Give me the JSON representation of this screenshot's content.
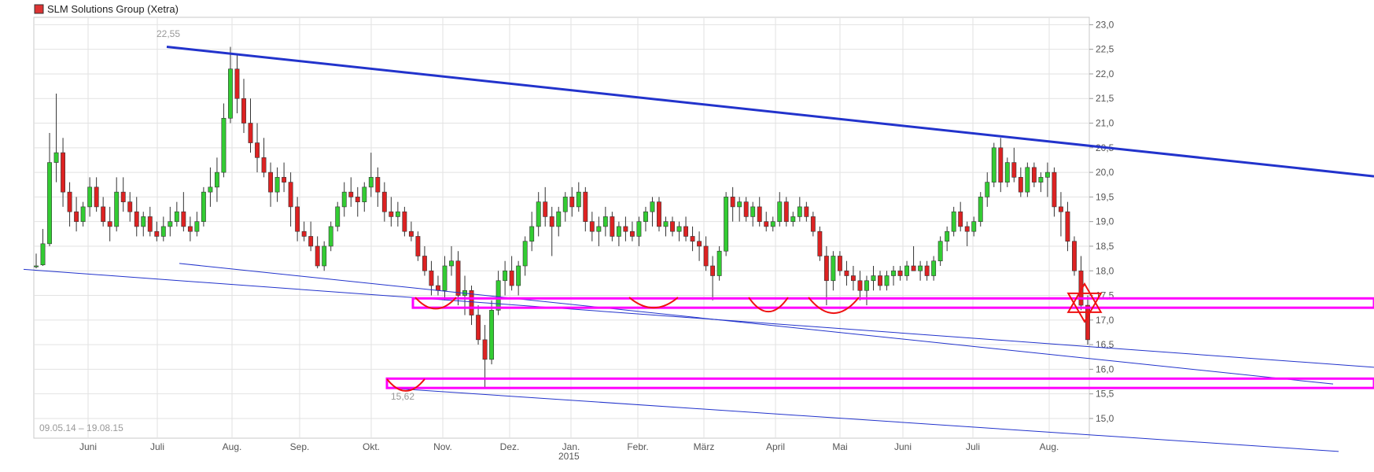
{
  "chart_data": {
    "type": "candlestick",
    "title": "SLM Solutions Group (Xetra)",
    "date_range": "09.05.14 – 19.08.15",
    "ylim": [
      14.6,
      23.15
    ],
    "y_ticks": [
      "15,0",
      "15,5",
      "16,0",
      "16,5",
      "17,0",
      "17,5",
      "18,0",
      "18,5",
      "19,0",
      "19,5",
      "20,0",
      "20,5",
      "21,0",
      "21,5",
      "22,0",
      "22,5",
      "23,0"
    ],
    "x_ticks": [
      "Juni",
      "Juli",
      "Aug.",
      "Sep.",
      "Okt.",
      "Nov.",
      "Dez.",
      "Jan.",
      "Febr.",
      "März",
      "April",
      "Mai",
      "Juni",
      "Juli",
      "Aug."
    ],
    "x_year_label": "2015",
    "annotations": {
      "high_label": "22,55",
      "low_label": "15,62"
    },
    "colors": {
      "up": "#33cc33",
      "down": "#dd2222",
      "trend": "#2233cc",
      "support": "#ff00ff",
      "marker": "#ee1111",
      "grid": "#e2e2e2"
    },
    "legend_position": "top-left",
    "grid": true,
    "ohlc": [
      [
        18.08,
        18.35,
        18.05,
        18.1
      ],
      [
        18.12,
        18.85,
        18.1,
        18.55
      ],
      [
        18.55,
        20.8,
        18.5,
        20.2
      ],
      [
        20.2,
        21.6,
        19.8,
        20.4
      ],
      [
        20.4,
        20.7,
        19.3,
        19.6
      ],
      [
        19.6,
        19.8,
        18.9,
        19.2
      ],
      [
        19.2,
        19.5,
        18.8,
        19.0
      ],
      [
        19.0,
        19.4,
        18.9,
        19.3
      ],
      [
        19.3,
        19.9,
        19.1,
        19.7
      ],
      [
        19.7,
        19.9,
        19.2,
        19.3
      ],
      [
        19.3,
        19.5,
        18.9,
        19.0
      ],
      [
        19.0,
        19.3,
        18.6,
        18.9
      ],
      [
        18.9,
        19.9,
        18.8,
        19.6
      ],
      [
        19.6,
        19.9,
        19.2,
        19.4
      ],
      [
        19.4,
        19.6,
        19.0,
        19.2
      ],
      [
        19.2,
        19.5,
        18.7,
        18.9
      ],
      [
        18.9,
        19.2,
        18.7,
        19.1
      ],
      [
        19.1,
        19.3,
        18.7,
        18.8
      ],
      [
        18.8,
        19.0,
        18.6,
        18.7
      ],
      [
        18.7,
        19.1,
        18.6,
        18.9
      ],
      [
        18.9,
        19.3,
        18.7,
        19.0
      ],
      [
        19.0,
        19.4,
        18.9,
        19.2
      ],
      [
        19.2,
        19.6,
        18.8,
        18.9
      ],
      [
        18.9,
        19.1,
        18.6,
        18.8
      ],
      [
        18.8,
        19.2,
        18.7,
        19.0
      ],
      [
        19.0,
        19.7,
        18.9,
        19.6
      ],
      [
        19.6,
        20.1,
        19.3,
        19.7
      ],
      [
        19.7,
        20.3,
        19.4,
        20.0
      ],
      [
        20.0,
        21.4,
        19.9,
        21.1
      ],
      [
        21.1,
        22.55,
        21.0,
        22.1
      ],
      [
        22.1,
        22.4,
        21.2,
        21.5
      ],
      [
        21.5,
        21.9,
        20.8,
        21.0
      ],
      [
        21.0,
        21.5,
        20.4,
        20.6
      ],
      [
        20.6,
        21.0,
        20.0,
        20.3
      ],
      [
        20.3,
        20.7,
        19.9,
        20.0
      ],
      [
        20.0,
        20.2,
        19.3,
        19.6
      ],
      [
        19.6,
        20.1,
        19.4,
        19.9
      ],
      [
        19.9,
        20.2,
        19.6,
        19.8
      ],
      [
        19.8,
        20.0,
        18.9,
        19.3
      ],
      [
        19.3,
        19.5,
        18.6,
        18.8
      ],
      [
        18.8,
        19.0,
        18.6,
        18.7
      ],
      [
        18.7,
        19.0,
        18.4,
        18.5
      ],
      [
        18.5,
        18.7,
        18.05,
        18.1
      ],
      [
        18.1,
        18.6,
        18.0,
        18.5
      ],
      [
        18.5,
        19.0,
        18.4,
        18.9
      ],
      [
        18.9,
        19.4,
        18.8,
        19.3
      ],
      [
        19.3,
        19.8,
        19.1,
        19.6
      ],
      [
        19.6,
        19.9,
        19.3,
        19.5
      ],
      [
        19.5,
        19.7,
        19.1,
        19.4
      ],
      [
        19.4,
        19.8,
        19.2,
        19.7
      ],
      [
        19.7,
        20.4,
        19.5,
        19.9
      ],
      [
        19.9,
        20.1,
        19.3,
        19.6
      ],
      [
        19.6,
        19.8,
        19.0,
        19.2
      ],
      [
        19.2,
        19.5,
        18.9,
        19.1
      ],
      [
        19.1,
        19.4,
        18.9,
        19.2
      ],
      [
        19.2,
        19.3,
        18.7,
        18.8
      ],
      [
        18.8,
        19.0,
        18.6,
        18.7
      ],
      [
        18.7,
        18.8,
        18.2,
        18.3
      ],
      [
        18.3,
        18.5,
        17.9,
        18.0
      ],
      [
        18.0,
        18.2,
        17.5,
        17.7
      ],
      [
        17.7,
        17.9,
        17.5,
        17.6
      ],
      [
        17.6,
        18.3,
        17.4,
        18.1
      ],
      [
        18.1,
        18.5,
        17.9,
        18.2
      ],
      [
        18.2,
        18.4,
        17.3,
        17.5
      ],
      [
        17.5,
        17.9,
        17.1,
        17.6
      ],
      [
        17.6,
        17.7,
        16.9,
        17.1
      ],
      [
        17.1,
        17.3,
        16.5,
        16.6
      ],
      [
        16.6,
        16.9,
        15.62,
        16.2
      ],
      [
        16.2,
        17.4,
        16.1,
        17.2
      ],
      [
        17.2,
        18.0,
        17.1,
        17.8
      ],
      [
        17.8,
        18.2,
        17.5,
        18.0
      ],
      [
        18.0,
        18.3,
        17.6,
        17.7
      ],
      [
        17.7,
        18.2,
        17.5,
        18.1
      ],
      [
        18.1,
        18.7,
        17.9,
        18.6
      ],
      [
        18.6,
        19.2,
        18.4,
        18.9
      ],
      [
        18.9,
        19.6,
        18.7,
        19.4
      ],
      [
        19.4,
        19.7,
        18.9,
        19.1
      ],
      [
        19.1,
        19.3,
        18.3,
        18.9
      ],
      [
        18.9,
        19.3,
        18.7,
        19.2
      ],
      [
        19.2,
        19.6,
        19.0,
        19.5
      ],
      [
        19.5,
        19.7,
        19.1,
        19.3
      ],
      [
        19.3,
        19.8,
        19.2,
        19.6
      ],
      [
        19.6,
        19.7,
        18.8,
        19.0
      ],
      [
        19.0,
        19.2,
        18.6,
        18.8
      ],
      [
        18.8,
        19.1,
        18.5,
        18.9
      ],
      [
        18.9,
        19.3,
        18.7,
        19.1
      ],
      [
        19.1,
        19.2,
        18.6,
        18.7
      ],
      [
        18.7,
        19.0,
        18.5,
        18.9
      ],
      [
        18.9,
        19.1,
        18.6,
        18.8
      ],
      [
        18.8,
        19.0,
        18.6,
        18.7
      ],
      [
        18.7,
        19.1,
        18.5,
        19.0
      ],
      [
        19.0,
        19.3,
        18.8,
        19.2
      ],
      [
        19.2,
        19.5,
        18.9,
        19.4
      ],
      [
        19.4,
        19.5,
        18.8,
        18.9
      ],
      [
        18.9,
        19.1,
        18.7,
        19.0
      ],
      [
        19.0,
        19.1,
        18.7,
        18.8
      ],
      [
        18.8,
        19.0,
        18.6,
        18.9
      ],
      [
        18.9,
        19.1,
        18.6,
        18.7
      ],
      [
        18.7,
        18.9,
        18.4,
        18.6
      ],
      [
        18.6,
        18.8,
        18.2,
        18.5
      ],
      [
        18.5,
        18.7,
        18.0,
        18.1
      ],
      [
        18.1,
        18.3,
        17.4,
        17.9
      ],
      [
        17.9,
        18.5,
        17.8,
        18.4
      ],
      [
        18.4,
        19.6,
        18.3,
        19.5
      ],
      [
        19.5,
        19.7,
        19.0,
        19.3
      ],
      [
        19.3,
        19.5,
        19.0,
        19.4
      ],
      [
        19.4,
        19.5,
        19.0,
        19.1
      ],
      [
        19.1,
        19.4,
        18.9,
        19.3
      ],
      [
        19.3,
        19.5,
        18.9,
        19.0
      ],
      [
        19.0,
        19.2,
        18.8,
        18.9
      ],
      [
        18.9,
        19.1,
        18.8,
        19.0
      ],
      [
        19.0,
        19.6,
        18.9,
        19.4
      ],
      [
        19.4,
        19.5,
        18.9,
        19.0
      ],
      [
        19.0,
        19.2,
        18.9,
        19.1
      ],
      [
        19.1,
        19.5,
        19.0,
        19.3
      ],
      [
        19.3,
        19.4,
        19.0,
        19.1
      ],
      [
        19.1,
        19.2,
        18.7,
        18.8
      ],
      [
        18.8,
        18.9,
        18.2,
        18.3
      ],
      [
        18.3,
        18.5,
        17.3,
        17.8
      ],
      [
        17.8,
        18.4,
        17.6,
        18.3
      ],
      [
        18.3,
        18.4,
        17.9,
        18.0
      ],
      [
        18.0,
        18.2,
        17.7,
        17.9
      ],
      [
        17.9,
        18.1,
        17.6,
        17.8
      ],
      [
        17.8,
        18.0,
        17.4,
        17.6
      ],
      [
        17.6,
        17.9,
        17.3,
        17.8
      ],
      [
        17.8,
        18.1,
        17.6,
        17.9
      ],
      [
        17.9,
        18.0,
        17.6,
        17.7
      ],
      [
        17.7,
        18.0,
        17.6,
        17.9
      ],
      [
        17.9,
        18.1,
        17.7,
        18.0
      ],
      [
        18.0,
        18.1,
        17.8,
        17.9
      ],
      [
        17.9,
        18.2,
        17.8,
        18.1
      ],
      [
        18.1,
        18.5,
        18.0,
        18.0
      ],
      [
        18.0,
        18.2,
        17.8,
        18.1
      ],
      [
        18.1,
        18.2,
        17.8,
        17.9
      ],
      [
        17.9,
        18.3,
        17.8,
        18.2
      ],
      [
        18.2,
        18.7,
        18.1,
        18.6
      ],
      [
        18.6,
        18.9,
        18.4,
        18.8
      ],
      [
        18.8,
        19.3,
        18.7,
        19.2
      ],
      [
        19.2,
        19.4,
        18.8,
        18.9
      ],
      [
        18.9,
        19.0,
        18.5,
        18.8
      ],
      [
        18.8,
        19.1,
        18.7,
        19.0
      ],
      [
        19.0,
        19.6,
        18.9,
        19.5
      ],
      [
        19.5,
        20.0,
        19.3,
        19.8
      ],
      [
        19.8,
        20.6,
        19.7,
        20.5
      ],
      [
        20.5,
        20.7,
        19.6,
        19.8
      ],
      [
        19.8,
        20.3,
        19.7,
        20.2
      ],
      [
        20.2,
        20.5,
        19.8,
        19.9
      ],
      [
        19.9,
        20.1,
        19.5,
        19.6
      ],
      [
        19.6,
        20.2,
        19.5,
        20.1
      ],
      [
        20.1,
        20.2,
        19.7,
        19.8
      ],
      [
        19.8,
        20.0,
        19.6,
        19.9
      ],
      [
        19.9,
        20.2,
        19.5,
        20.0
      ],
      [
        20.0,
        20.1,
        19.1,
        19.3
      ],
      [
        19.3,
        19.6,
        18.7,
        19.2
      ],
      [
        19.2,
        19.4,
        18.4,
        18.6
      ],
      [
        18.6,
        18.7,
        17.9,
        18.0
      ],
      [
        18.0,
        18.3,
        17.2,
        17.3
      ],
      [
        17.3,
        17.5,
        16.5,
        16.6
      ]
    ]
  },
  "legend": {
    "label": "SLM Solutions Group (Xetra)",
    "swatch": "#dd3333"
  }
}
